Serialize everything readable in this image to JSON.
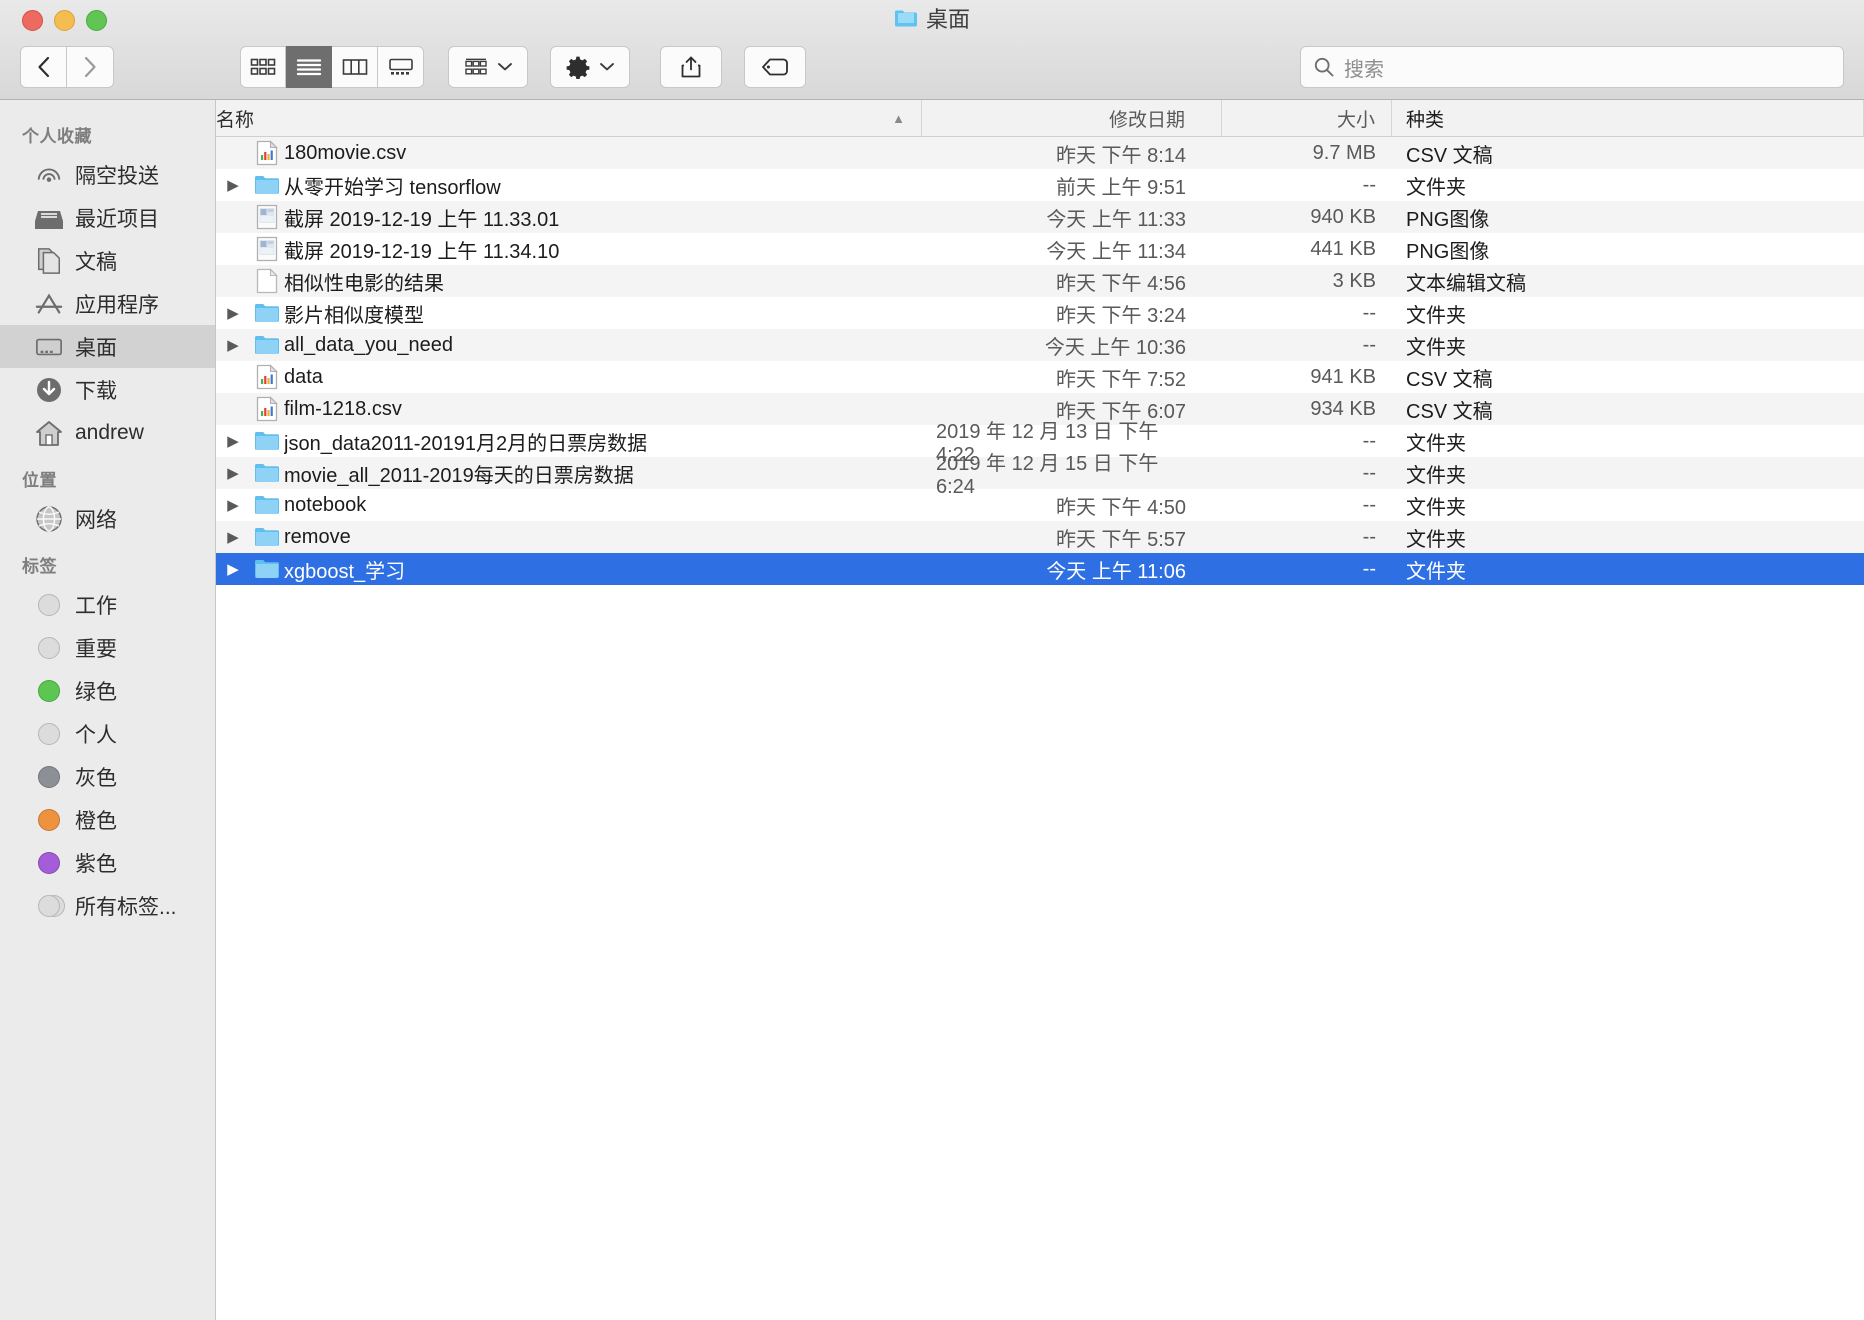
{
  "window": {
    "title": "桌面",
    "title_icon": "folder-icon"
  },
  "toolbar": {
    "back_icon": "chevron-left-icon",
    "forward_icon": "chevron-right-icon",
    "view_icon_grid": "icon-view-icon",
    "view_list": "list-view-icon",
    "view_columns": "column-view-icon",
    "view_gallery": "gallery-view-icon",
    "group_icon": "group-by-icon",
    "action_icon": "gear-icon",
    "share_icon": "share-icon",
    "tag_icon": "tag-icon",
    "chevron_icon": "chevron-down-icon"
  },
  "search": {
    "icon": "search-icon",
    "placeholder": "搜索",
    "value": ""
  },
  "sidebar": {
    "sections": [
      {
        "header": "个人收藏",
        "items": [
          {
            "label": "隔空投送",
            "icon": "airdrop-icon",
            "selected": false
          },
          {
            "label": "最近项目",
            "icon": "recents-icon",
            "selected": false
          },
          {
            "label": "文稿",
            "icon": "documents-icon",
            "selected": false
          },
          {
            "label": "应用程序",
            "icon": "applications-icon",
            "selected": false
          },
          {
            "label": "桌面",
            "icon": "desktop-icon",
            "selected": true
          },
          {
            "label": "下载",
            "icon": "downloads-icon",
            "selected": false
          },
          {
            "label": "andrew",
            "icon": "home-icon",
            "selected": false
          }
        ]
      },
      {
        "header": "位置",
        "items": [
          {
            "label": "网络",
            "icon": "network-icon",
            "selected": false
          }
        ]
      },
      {
        "header": "标签",
        "items": [
          {
            "label": "工作",
            "icon": "tag-dot-icon",
            "color": "none",
            "selected": false
          },
          {
            "label": "重要",
            "icon": "tag-dot-icon",
            "color": "none",
            "selected": false
          },
          {
            "label": "绿色",
            "icon": "tag-dot-icon",
            "color": "#5cc653",
            "selected": false
          },
          {
            "label": "个人",
            "icon": "tag-dot-icon",
            "color": "none",
            "selected": false
          },
          {
            "label": "灰色",
            "icon": "tag-dot-icon",
            "color": "#8c8f96",
            "selected": false
          },
          {
            "label": "橙色",
            "icon": "tag-dot-icon",
            "color": "#ef9240",
            "selected": false
          },
          {
            "label": "紫色",
            "icon": "tag-dot-icon",
            "color": "#a45cd8",
            "selected": false
          },
          {
            "label": "所有标签...",
            "icon": "all-tags-icon",
            "color": "none",
            "selected": false
          }
        ]
      }
    ]
  },
  "columns": {
    "name": "名称",
    "date": "修改日期",
    "size": "大小",
    "kind": "种类",
    "sort_column": "名称",
    "sort_direction": "ascending",
    "sort_caret": "▲"
  },
  "files": [
    {
      "name": "180movie.csv",
      "date": "昨天 下午 8:14",
      "size": "9.7 MB",
      "kind": "CSV 文稿",
      "icon": "csv-file-icon",
      "expandable": false,
      "selected": false
    },
    {
      "name": "从零开始学习 tensorflow",
      "date": "前天 上午 9:51",
      "size": "--",
      "kind": "文件夹",
      "icon": "folder-icon",
      "expandable": true,
      "selected": false
    },
    {
      "name": "截屏 2019-12-19 上午 11.33.01",
      "date": "今天 上午 11:33",
      "size": "940 KB",
      "kind": "PNG图像",
      "icon": "png-image-icon",
      "expandable": false,
      "selected": false
    },
    {
      "name": "截屏 2019-12-19 上午 11.34.10",
      "date": "今天 上午 11:34",
      "size": "441 KB",
      "kind": "PNG图像",
      "icon": "png-image-icon",
      "expandable": false,
      "selected": false
    },
    {
      "name": "相似性电影的结果",
      "date": "昨天 下午 4:56",
      "size": "3 KB",
      "kind": "文本编辑文稿",
      "icon": "text-file-icon",
      "expandable": false,
      "selected": false
    },
    {
      "name": "影片相似度模型",
      "date": "昨天 下午 3:24",
      "size": "--",
      "kind": "文件夹",
      "icon": "folder-icon",
      "expandable": true,
      "selected": false
    },
    {
      "name": "all_data_you_need",
      "date": "今天 上午 10:36",
      "size": "--",
      "kind": "文件夹",
      "icon": "folder-icon",
      "expandable": true,
      "selected": false
    },
    {
      "name": "data",
      "date": "昨天 下午 7:52",
      "size": "941 KB",
      "kind": "CSV 文稿",
      "icon": "csv-file-icon",
      "expandable": false,
      "selected": false
    },
    {
      "name": "film-1218.csv",
      "date": "昨天 下午 6:07",
      "size": "934 KB",
      "kind": "CSV 文稿",
      "icon": "csv-file-icon",
      "expandable": false,
      "selected": false
    },
    {
      "name": "json_data2011-20191月2月的日票房数据",
      "date": "2019 年 12 月 13 日 下午 4:22",
      "size": "--",
      "kind": "文件夹",
      "icon": "folder-icon",
      "expandable": true,
      "selected": false
    },
    {
      "name": "movie_all_2011-2019每天的日票房数据",
      "date": "2019 年 12 月 15 日 下午 6:24",
      "size": "--",
      "kind": "文件夹",
      "icon": "folder-icon",
      "expandable": true,
      "selected": false
    },
    {
      "name": "notebook",
      "date": "昨天 下午 4:50",
      "size": "--",
      "kind": "文件夹",
      "icon": "folder-icon",
      "expandable": true,
      "selected": false
    },
    {
      "name": "remove",
      "date": "昨天 下午 5:57",
      "size": "--",
      "kind": "文件夹",
      "icon": "folder-icon",
      "expandable": true,
      "selected": false
    },
    {
      "name": "xgboost_学习",
      "date": "今天 上午 11:06",
      "size": "--",
      "kind": "文件夹",
      "icon": "folder-icon",
      "expandable": true,
      "selected": true
    }
  ],
  "colors": {
    "selection": "#2f6fe4",
    "folder": "#6fc3f0",
    "sidebar_bg": "#ebebeb"
  }
}
